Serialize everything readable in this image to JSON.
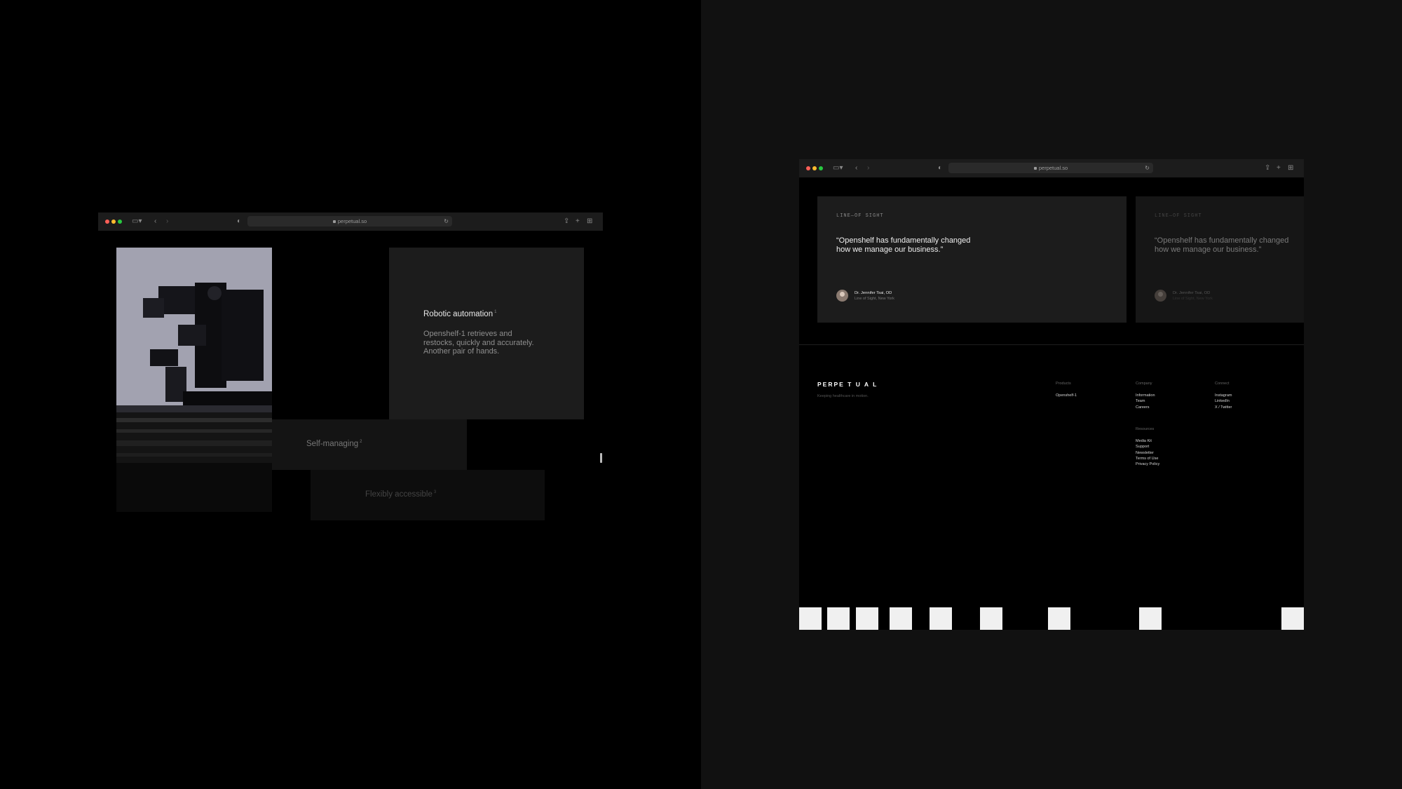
{
  "left_browser": {
    "url": "perpetual.so",
    "feature_active": {
      "title": "Robotic automation",
      "sup": "1",
      "body_lines": [
        "Openshelf-1 retrieves and",
        "restocks, quickly and accurately.",
        "Another pair of hands."
      ]
    },
    "feature_2": {
      "title": "Self-managing",
      "sup": "2"
    },
    "feature_3": {
      "title": "Flexibly accessible",
      "sup": "3"
    }
  },
  "right_browser": {
    "url": "perpetual.so",
    "testimonial": {
      "tag": "LINE—OF SIGHT",
      "quote_lines": [
        "“Openshelf has fundamentally changed",
        "how we manage our business.”"
      ],
      "author": "Dr. Jennifer Tsai, OD",
      "author_sub": "Line of Sight, New York"
    },
    "testimonial_next": {
      "tag": "LINE—OF SIGHT",
      "quote_lines": [
        "“Openshelf has fundamentally changed",
        "how we manage our business.”"
      ],
      "author": "Dr. Jennifer Tsai, OD",
      "author_sub": "Line of Sight, New York"
    },
    "footer": {
      "logo": "PERPE T U A L",
      "tagline": "Keeping healthcare in motion.",
      "products": {
        "heading": "Products",
        "links": [
          "Openshelf-1"
        ]
      },
      "company": {
        "heading": "Company",
        "links": [
          "Information",
          "Team",
          "Careers"
        ]
      },
      "connect": {
        "heading": "Connect",
        "links": [
          "Instagram",
          "LinkedIn",
          "X / Twitter"
        ]
      },
      "resources": {
        "heading": "Resources",
        "links": [
          "Media Kit",
          "Support",
          "Newsletter",
          "Terms of Use",
          "Privacy Policy"
        ]
      }
    }
  },
  "colors": {
    "background_left": "#000000",
    "background_right": "#111111",
    "card": "#1c1c1c",
    "traffic_red": "#ff5f57",
    "traffic_yellow": "#febc2e",
    "traffic_green": "#28c840"
  }
}
